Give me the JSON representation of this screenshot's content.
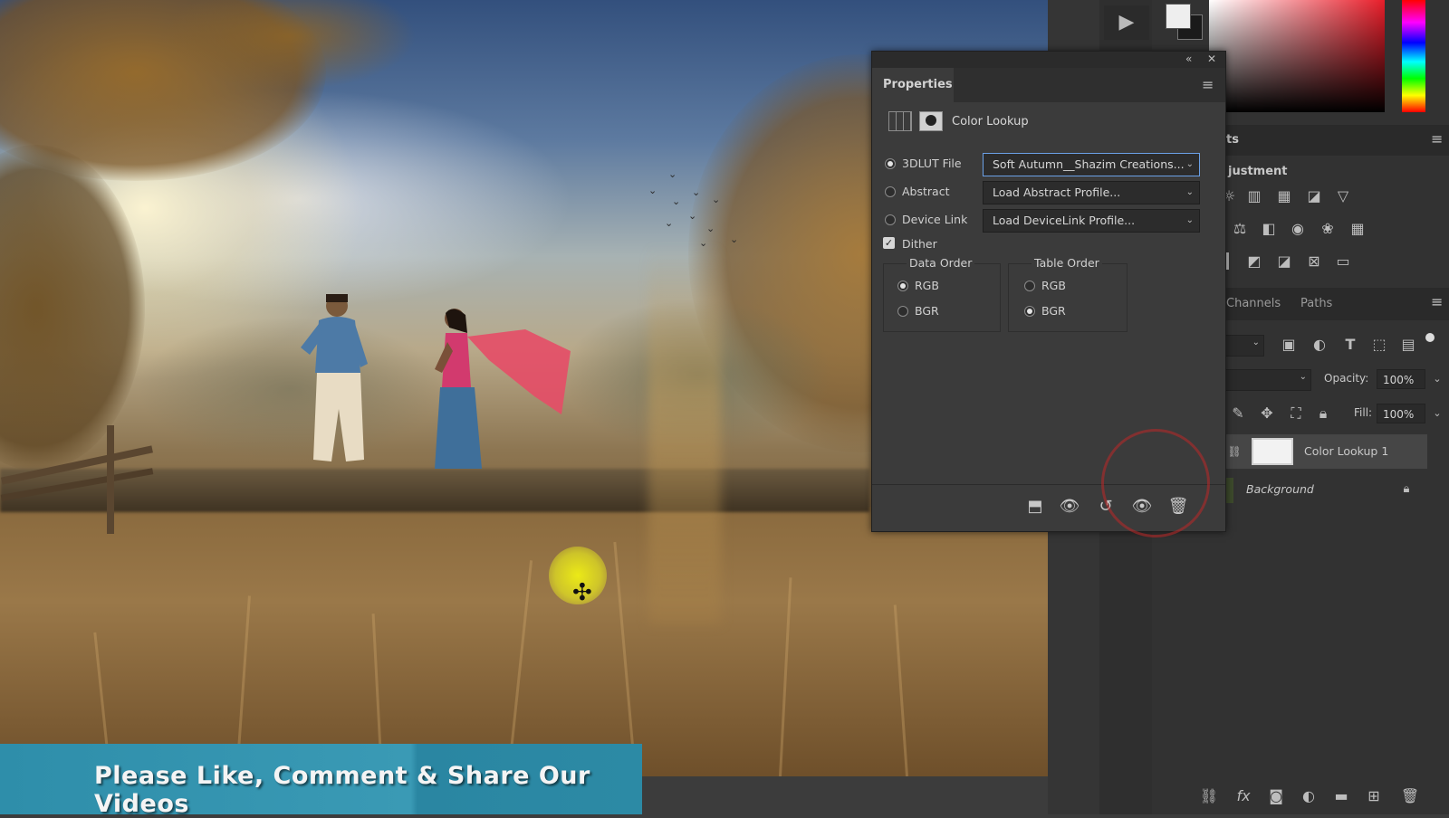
{
  "properties_panel": {
    "tab_label": "Properties",
    "adjustment_title": "Color Lookup",
    "options": [
      {
        "label": "3DLUT File",
        "selected": true,
        "dropdown": "Soft  Autumn__Shazim  Creations..."
      },
      {
        "label": "Abstract",
        "selected": false,
        "dropdown": "Load Abstract Profile..."
      },
      {
        "label": "Device Link",
        "selected": false,
        "dropdown": "Load DeviceLink Profile..."
      }
    ],
    "dither_label": "Dither",
    "dither_checked": true,
    "data_order": {
      "title": "Data Order",
      "rgb": "RGB",
      "bgr": "BGR",
      "selected": "RGB"
    },
    "table_order": {
      "title": "Table Order",
      "rgb": "RGB",
      "bgr": "BGR",
      "selected": "BGR"
    }
  },
  "right_panel": {
    "adjustments_tab_partial": "ts",
    "adjustments_heading_partial": "justment",
    "channels_tab": "Channels",
    "paths_tab": "Paths",
    "opacity_label": "Opacity:",
    "opacity_value": "100%",
    "fill_label": "Fill:",
    "fill_value": "100%",
    "layers": [
      {
        "name": "Color Lookup 1"
      },
      {
        "name": "Background"
      }
    ]
  },
  "banner": {
    "text": "Please Like, Comment & Share Our Videos"
  },
  "colors": {
    "banner_blue": "#3a9ab5",
    "panel_bg": "#3b3b3b",
    "highlight_yellow": "#ecec1e"
  }
}
